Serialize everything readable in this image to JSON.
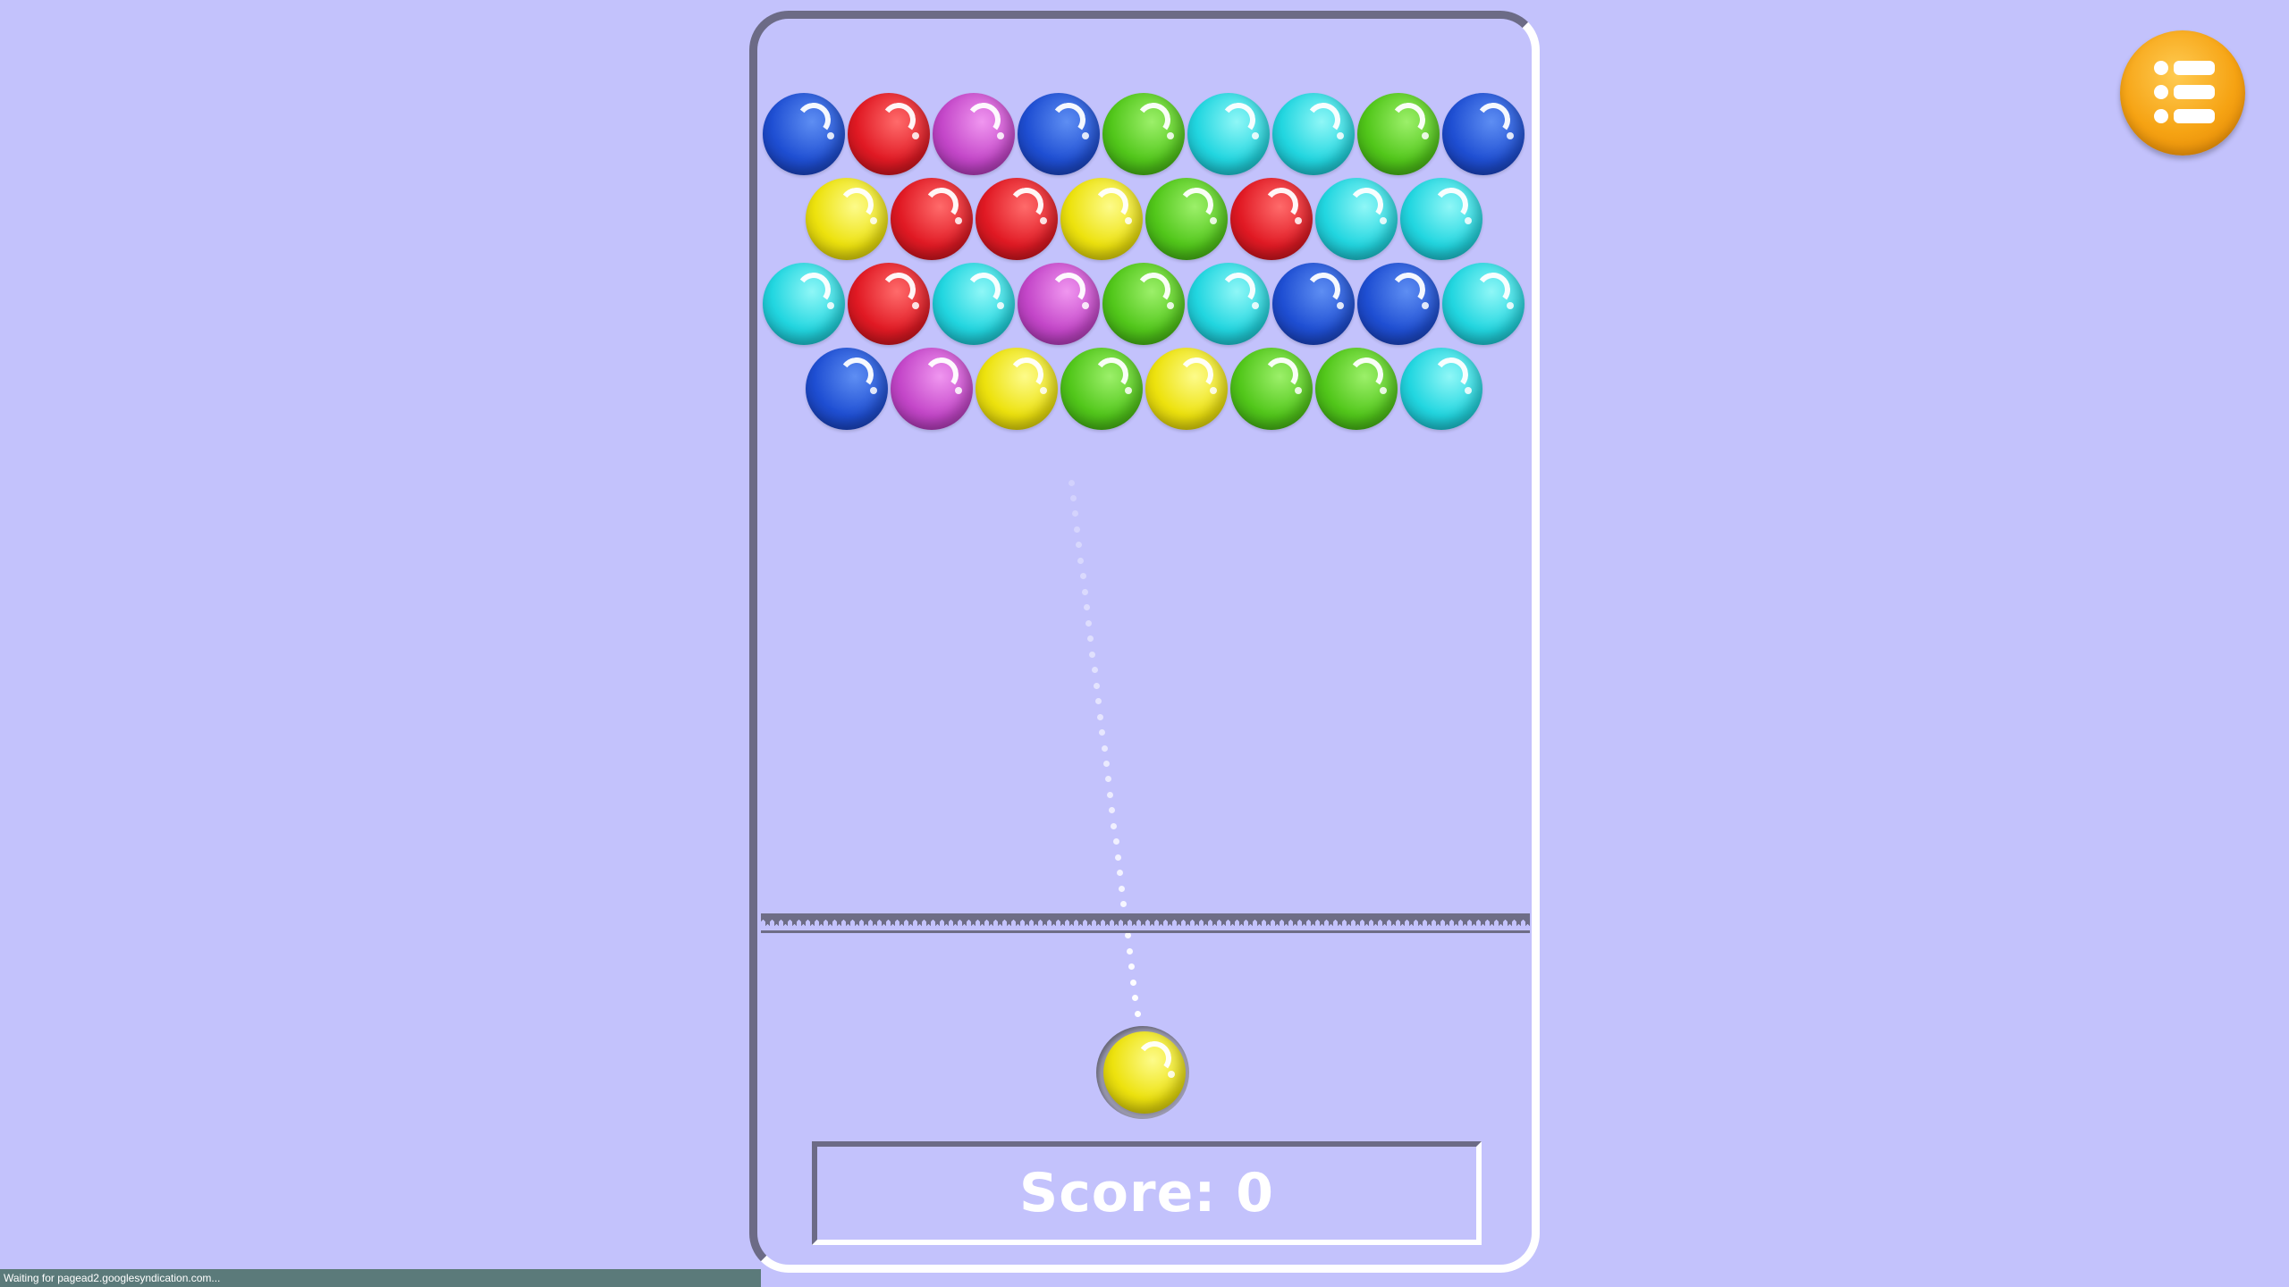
{
  "score": {
    "label": "Score: 0",
    "value": 0
  },
  "menu_button": {
    "icon": "list-menu-icon",
    "color": "#f6a313"
  },
  "status_bar": {
    "text": "Waiting for pagead2.googlesyndication.com..."
  },
  "colors": {
    "background": "#c3c2fc",
    "frame_dark": "#6c6b86",
    "frame_light": "#ffffff"
  },
  "bubble_grid": [
    [
      "blue",
      "red",
      "magenta",
      "blue",
      "green",
      "cyan",
      "cyan",
      "green",
      "blue"
    ],
    [
      "yellow",
      "red",
      "red",
      "yellow",
      "green",
      "red",
      "cyan",
      "cyan"
    ],
    [
      "cyan",
      "red",
      "cyan",
      "magenta",
      "green",
      "cyan",
      "blue",
      "blue",
      "cyan"
    ],
    [
      "blue",
      "magenta",
      "yellow",
      "green",
      "yellow",
      "green",
      "green",
      "cyan"
    ]
  ],
  "shooter": {
    "current_bubble": "yellow"
  }
}
